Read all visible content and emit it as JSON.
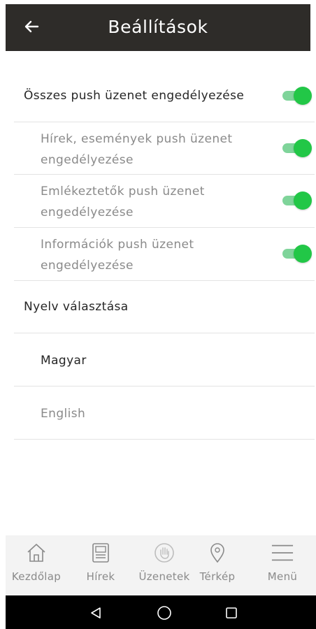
{
  "header": {
    "title": "Beállítások"
  },
  "settings": {
    "all_push": "Összes push üzenet engedélyezése",
    "news_push_l1": "Hírek, események push üzenet",
    "news_push_l2": "engedélyezése",
    "reminder_push_l1": "Emlékeztetők push üzenet",
    "reminder_push_l2": "engedélyezése",
    "info_push_l1": "Információk push üzenet",
    "info_push_l2": "engedélyezése",
    "toggle_states": [
      true,
      true,
      true,
      true
    ],
    "toggle_color": "#22c747"
  },
  "language": {
    "header": "Nyelv választása",
    "options": [
      "Magyar",
      "English"
    ],
    "selected": "Magyar"
  },
  "nav": {
    "items": [
      {
        "label": "Kezdőlap",
        "icon": "home-icon"
      },
      {
        "label": "Hírek",
        "icon": "news-icon"
      },
      {
        "label": "Üzenetek",
        "icon": "hand-icon"
      },
      {
        "label": "Térkép",
        "icon": "map-pin-icon"
      },
      {
        "label": "Menü",
        "icon": "menu-icon"
      }
    ]
  },
  "colors": {
    "topbar": "#2e2c29",
    "accent": "#22c747"
  }
}
